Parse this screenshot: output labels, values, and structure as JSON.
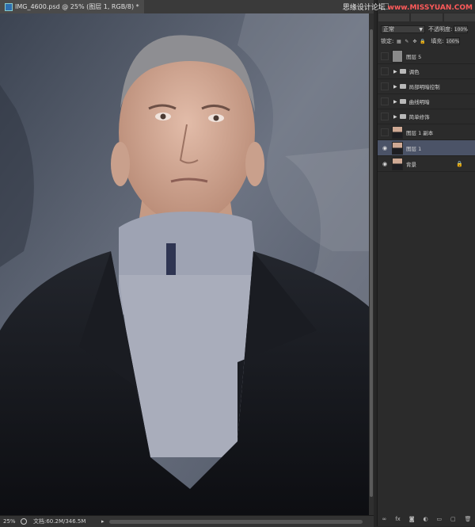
{
  "document": {
    "tab_title": "IMG_4600.psd @ 25% (图层 1, RGB/8) *",
    "zoom": "25%",
    "doc_info": "文档:60.2M/346.5M"
  },
  "watermark": {
    "prefix": "思缘设计论坛",
    "site": "www.MISSYUAN.COM"
  },
  "layers_panel": {
    "blend_mode": "正常",
    "opacity_label": "不透明度:",
    "opacity_value": "100%",
    "lock_label": "锁定:",
    "fill_label": "填充:",
    "fill_value": "100%",
    "layers": [
      {
        "name": "图层 5",
        "type": "pixel",
        "visible": false
      },
      {
        "name": "调色",
        "type": "group",
        "visible": false
      },
      {
        "name": "局部明暗控制",
        "type": "group",
        "visible": false
      },
      {
        "name": "曲线明暗",
        "type": "group",
        "visible": false
      },
      {
        "name": "简单修饰",
        "type": "group",
        "visible": false
      },
      {
        "name": "图层 1 副本",
        "type": "pixel",
        "visible": false
      },
      {
        "name": "图层 1",
        "type": "pixel",
        "visible": true,
        "selected": true
      },
      {
        "name": "背景",
        "type": "background",
        "visible": true,
        "locked": true
      }
    ]
  },
  "colors": {
    "selected_layer": "#4b5367",
    "watermark_accent": "#ff5a5a"
  }
}
